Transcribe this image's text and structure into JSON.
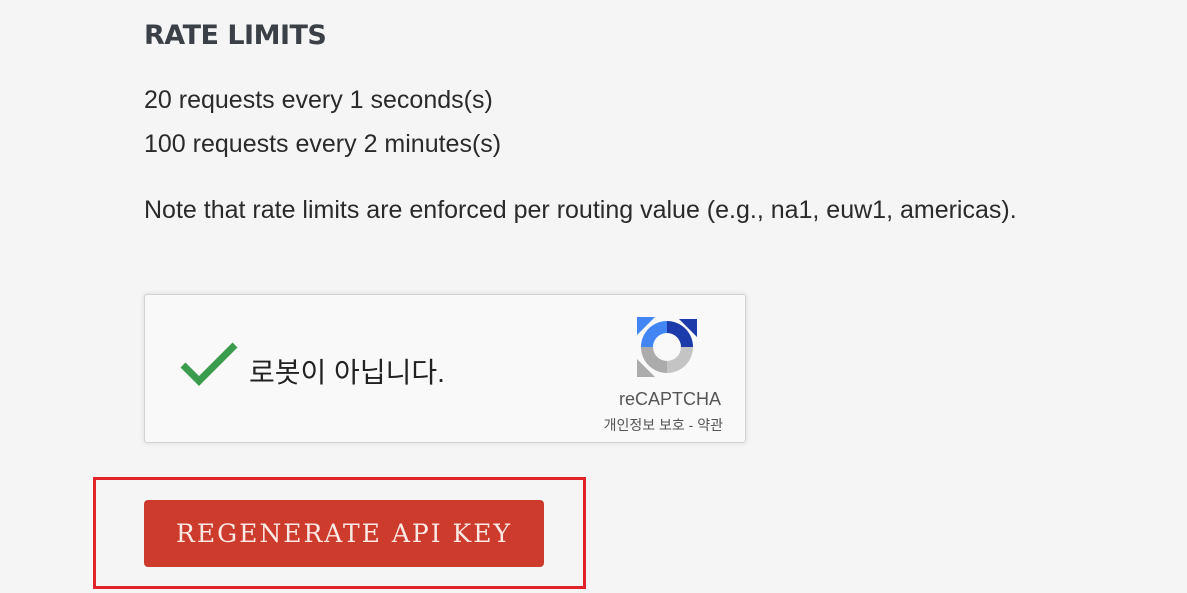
{
  "rate_limits": {
    "heading": "RATE LIMITS",
    "lines": [
      "20 requests every 1 seconds(s)",
      "100 requests every 2 minutes(s)"
    ],
    "note": "Note that rate limits are enforced per routing value (e.g., na1, euw1, americas)."
  },
  "captcha": {
    "label": "로봇이 아닙니다.",
    "brand": "reCAPTCHA",
    "privacy_link": "개인정보 보호",
    "separator": " - ",
    "terms_link": "약관",
    "checked": true,
    "check_color": "#3c9c4e"
  },
  "actions": {
    "regenerate_label": "REGENERATE API KEY",
    "button_color": "#cc3b2c",
    "highlight_color": "#e3232b"
  }
}
